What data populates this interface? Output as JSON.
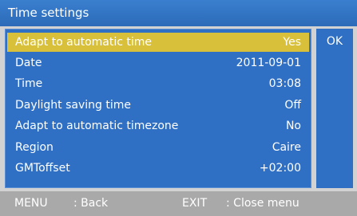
{
  "window": {
    "title": "Time settings"
  },
  "settings": [
    {
      "label": "Adapt to automatic time",
      "value": "Yes"
    },
    {
      "label": "Date",
      "value": "2011-09-01"
    },
    {
      "label": "Time",
      "value": "03:08"
    },
    {
      "label": "Daylight saving time",
      "value": "Off"
    },
    {
      "label": "Adapt to automatic timezone",
      "value": "No"
    },
    {
      "label": "Region",
      "value": "Caire"
    },
    {
      "label": "GMToffset",
      "value": "+02:00"
    }
  ],
  "side": {
    "ok_label": "OK"
  },
  "footer": {
    "menu_key": "MENU",
    "menu_action": ": Back",
    "exit_key": "EXIT",
    "exit_action": ": Close menu"
  },
  "colors": {
    "title_bar": "#2c6bb8",
    "panel": "#2f6fc4",
    "selection": "#d8c03a",
    "footer": "#a9a9a9",
    "background": "#d2d2d2"
  }
}
